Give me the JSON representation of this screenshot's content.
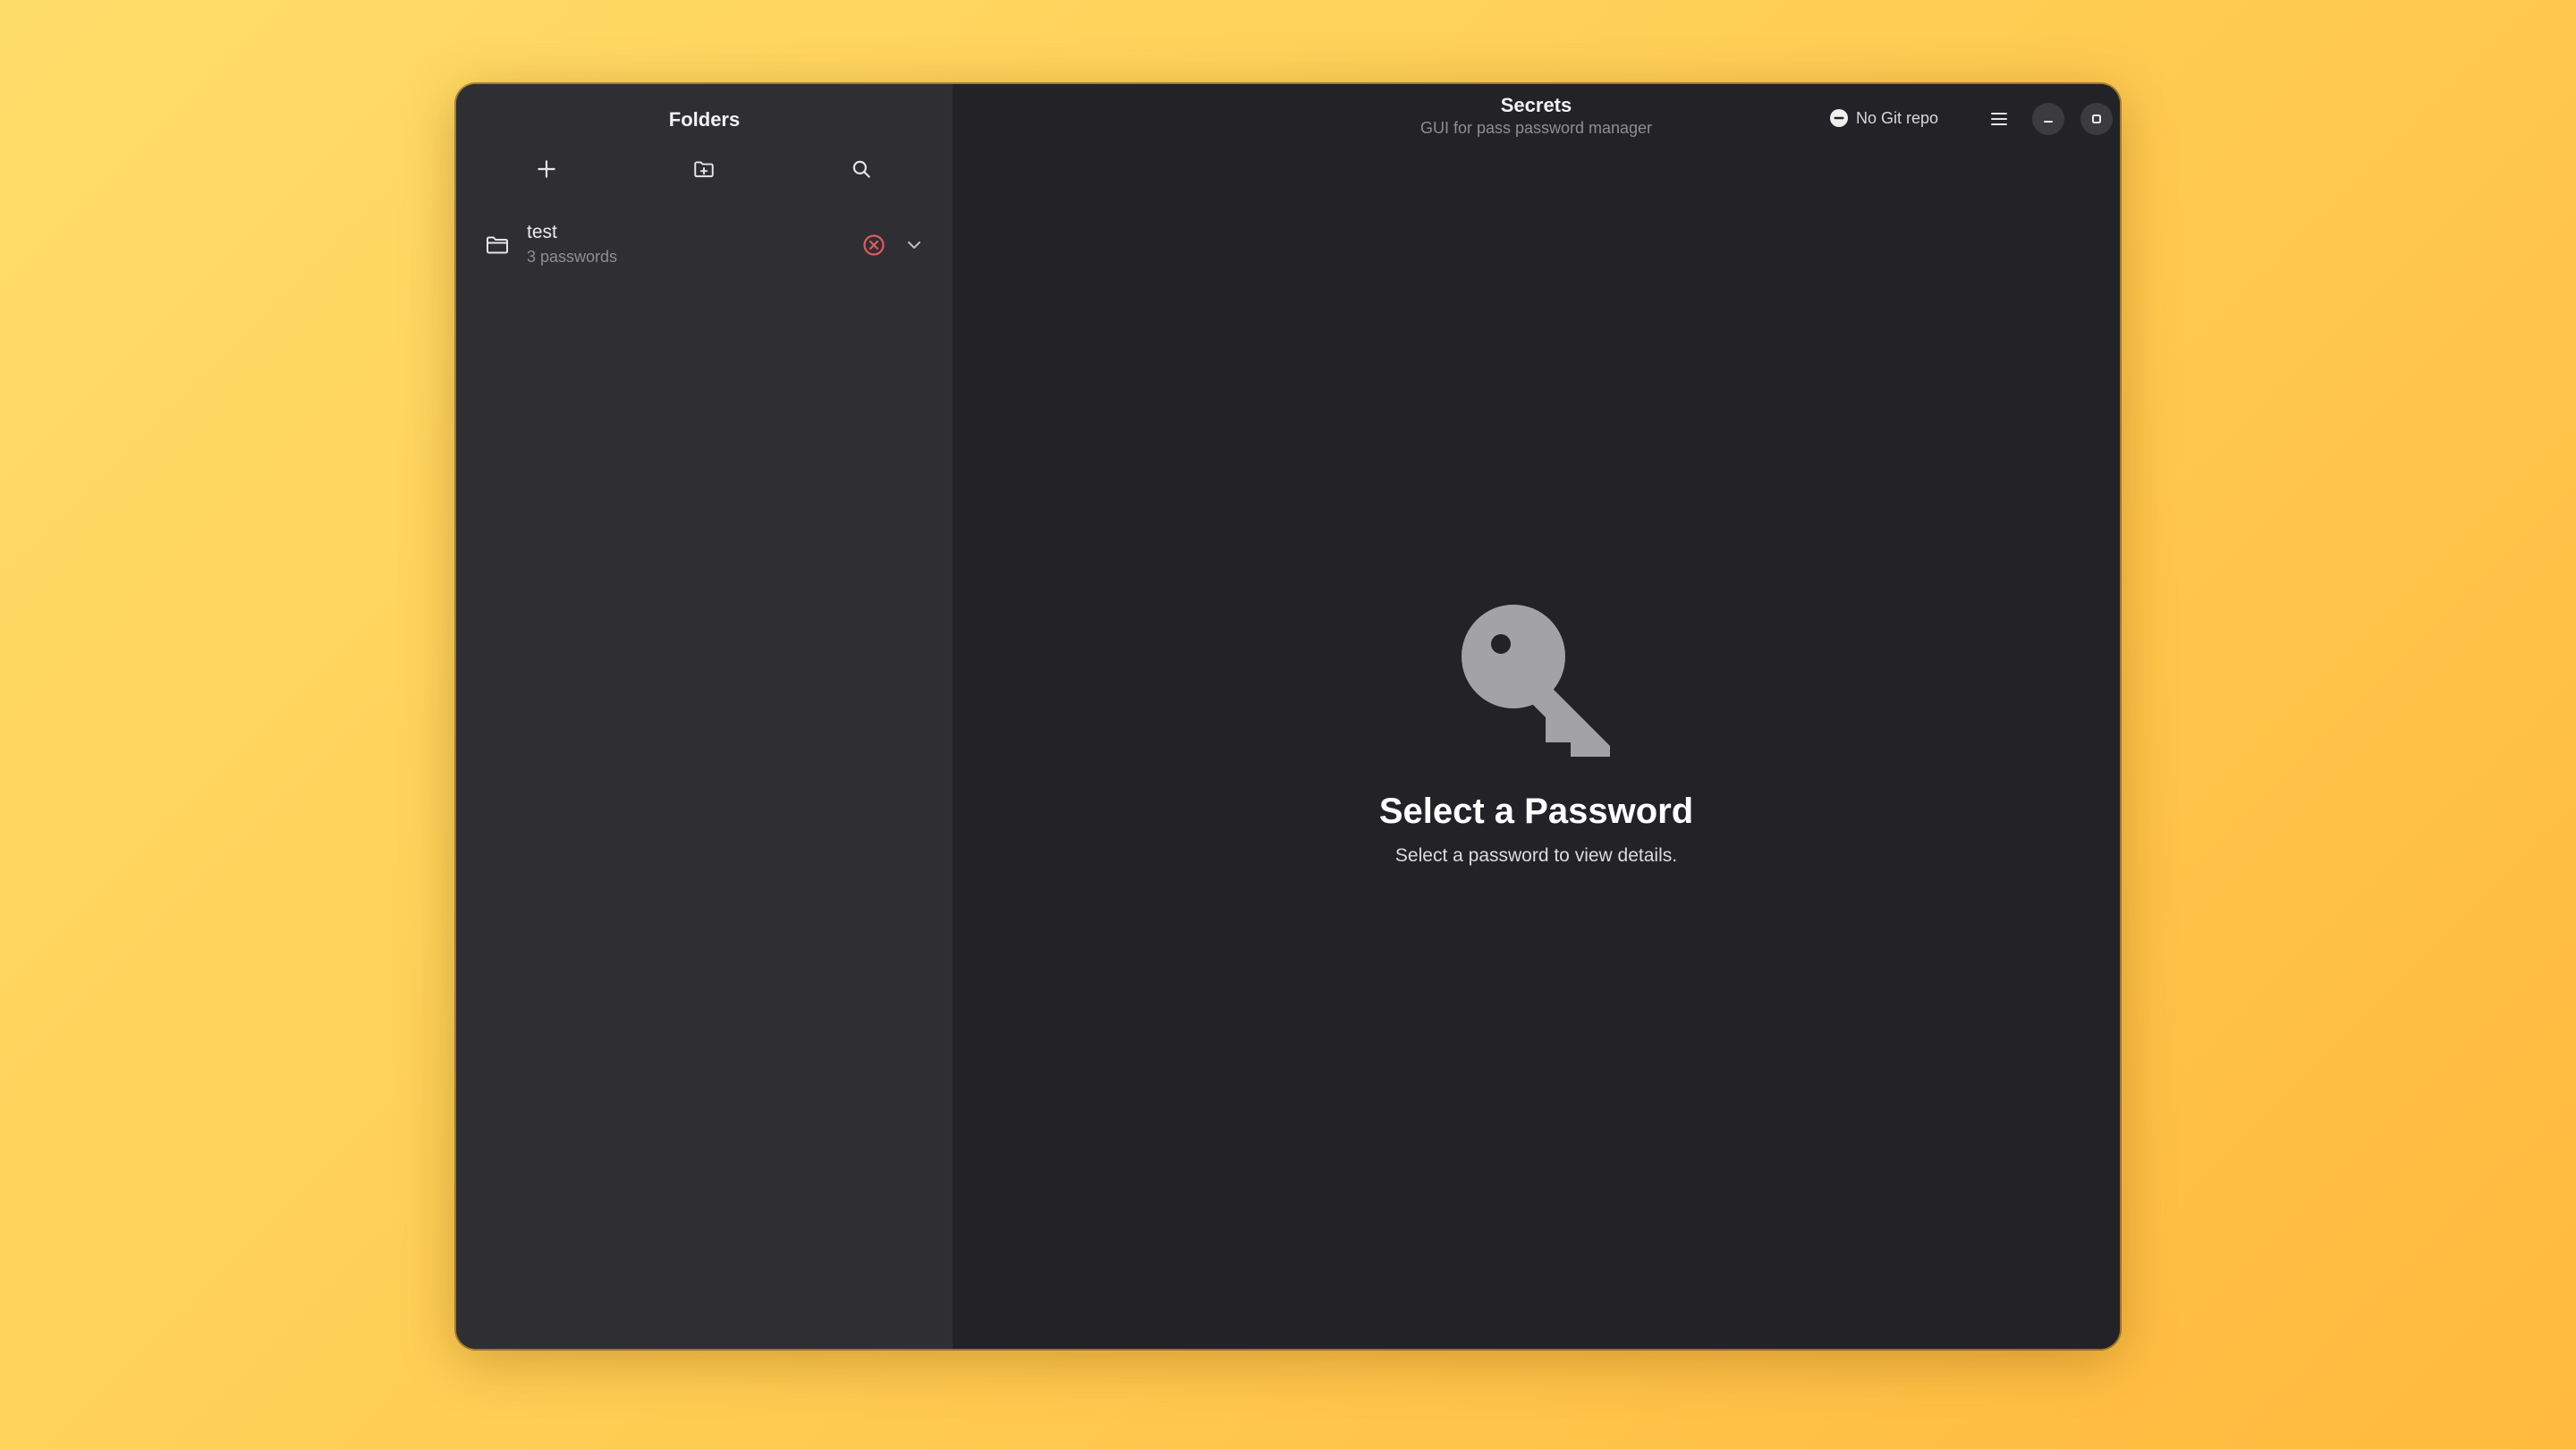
{
  "sidebar": {
    "title": "Folders",
    "toolbar": [
      {
        "name": "add-password-button",
        "icon": "plus-icon"
      },
      {
        "name": "new-folder-button",
        "icon": "folder-new-icon"
      },
      {
        "name": "search-button",
        "icon": "search-icon"
      }
    ],
    "folders": [
      {
        "name": "test",
        "count": "3 passwords",
        "icon": "folder-icon",
        "status_icon": "error-circle-icon",
        "status_color": "#e05a5a"
      }
    ]
  },
  "header": {
    "title": "Secrets",
    "subtitle": "GUI for pass password manager",
    "git_status": "No Git repo",
    "git_icon": "minus-circle-icon"
  },
  "main": {
    "status_icon": "key-icon",
    "status_title": "Select a Password",
    "status_description": "Select a password to view details."
  },
  "colors": {
    "sidebar_bg": "#2f2f33",
    "content_bg": "#232327",
    "icon_gray": "#9a9a9e",
    "error": "#e05a5a"
  }
}
